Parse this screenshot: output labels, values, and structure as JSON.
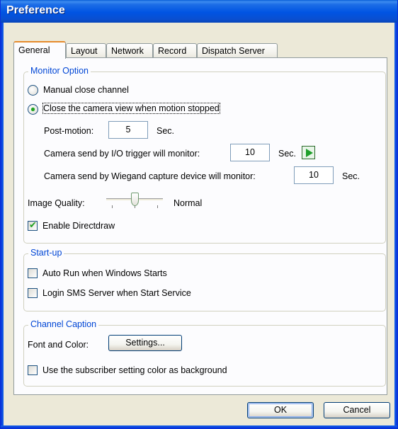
{
  "window": {
    "title": "Preference"
  },
  "tabs": [
    {
      "label": "General",
      "active": true
    },
    {
      "label": "Layout",
      "active": false
    },
    {
      "label": "Network",
      "active": false
    },
    {
      "label": "Record",
      "active": false
    },
    {
      "label": "Dispatch Server",
      "active": false
    }
  ],
  "monitor_option": {
    "title": "Monitor Option",
    "manual_close_label": "Manual close channel",
    "manual_close_selected": false,
    "close_on_motion_label": "Close the camera view when motion stopped",
    "close_on_motion_selected": true,
    "post_motion_label": "Post-motion:",
    "post_motion_value": "5",
    "post_motion_unit": "Sec.",
    "io_trigger_label": "Camera send by I/O trigger will monitor:",
    "io_trigger_value": "10",
    "io_trigger_unit": "Sec.",
    "wiegand_label": "Camera send by Wiegand capture device will monitor:",
    "wiegand_value": "10",
    "wiegand_unit": "Sec.",
    "image_quality_label": "Image Quality:",
    "image_quality_value": "Normal",
    "image_quality_level": 0.5,
    "directdraw_label": "Enable Directdraw",
    "directdraw_checked": true
  },
  "startup": {
    "title": "Start-up",
    "auto_run_label": "Auto Run when Windows Starts",
    "auto_run_checked": false,
    "login_sms_label": "Login SMS Server when Start Service",
    "login_sms_checked": false
  },
  "channel_caption": {
    "title": "Channel Caption",
    "font_color_label": "Font and Color:",
    "settings_button": "Settings...",
    "subscriber_color_label": "Use the subscriber setting color as background",
    "subscriber_color_checked": false
  },
  "footer": {
    "ok_label": "OK",
    "cancel_label": "Cancel"
  },
  "colors": {
    "titlebar": "#0054e3",
    "group_title": "#0046d5",
    "active_tab_accent": "#e68b2c",
    "check_green": "#21a121"
  },
  "icons": {
    "io_trigger_action": "play-arrow-icon"
  }
}
